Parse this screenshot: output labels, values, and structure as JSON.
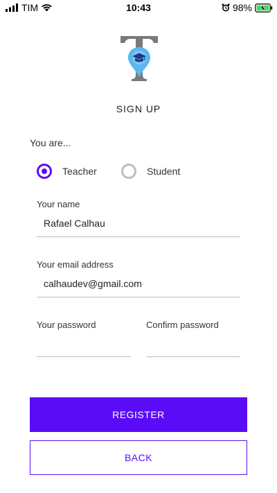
{
  "status_bar": {
    "carrier": "TIM",
    "time": "10:43",
    "battery_percent": "98%",
    "battery_level": 0.98,
    "icons": [
      "signal-icon",
      "wifi-icon",
      "alarm-icon",
      "battery-charging-icon"
    ]
  },
  "app": {
    "logo_icon": "teacher-logo-icon",
    "title": "SIGN UP"
  },
  "form": {
    "role_prompt": "You are...",
    "roles": [
      {
        "label": "Teacher",
        "selected": true
      },
      {
        "label": "Student",
        "selected": false
      }
    ],
    "name": {
      "label": "Your name",
      "value": "Rafael Calhau"
    },
    "email": {
      "label": "Your email address",
      "value": "calhaudev@gmail.com"
    },
    "password": {
      "label": "Your password",
      "value": ""
    },
    "confirm_password": {
      "label": "Confirm password",
      "value": ""
    }
  },
  "actions": {
    "register_label": "REGISTER",
    "back_label": "BACK"
  },
  "colors": {
    "accent": "#5b0cf6",
    "logo_pin": "#5ab8f0",
    "logo_letter": "#7a7a7a"
  }
}
